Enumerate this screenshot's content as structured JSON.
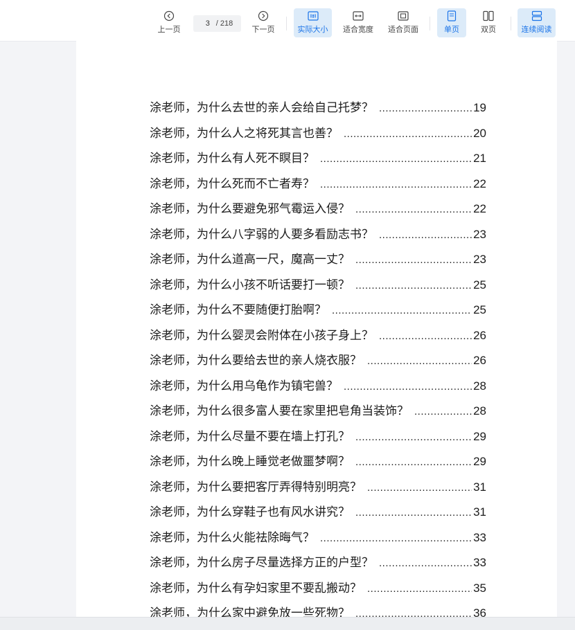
{
  "toolbar": {
    "prev_label": "上一页",
    "next_label": "下一页",
    "current_page": "3",
    "total_pages": "/ 218",
    "actual_size_label": "实际大小",
    "fit_width_label": "适合宽度",
    "fit_page_label": "适合页面",
    "single_page_label": "单页",
    "double_page_label": "双页",
    "continuous_label": "连续阅读",
    "accent_color": "#1a73e8"
  },
  "toc": [
    {
      "title": "涂老师，为什么去世的亲人会给自己托梦？",
      "page": "19"
    },
    {
      "title": "涂老师，为什么人之将死其言也善？",
      "page": "20"
    },
    {
      "title": "涂老师，为什么有人死不瞑目？",
      "page": "21"
    },
    {
      "title": "涂老师，为什么死而不亡者寿？",
      "page": "22"
    },
    {
      "title": "涂老师，为什么要避免邪气霉运入侵？",
      "page": "22"
    },
    {
      "title": "涂老师，为什么八字弱的人要多看励志书？",
      "page": "23"
    },
    {
      "title": "涂老师，为什么道高一尺，魔高一丈？",
      "page": "23"
    },
    {
      "title": "涂老师，为什么小孩不听话要打一顿？",
      "page": "25"
    },
    {
      "title": "涂老师，为什么不要随便打胎啊？",
      "page": "25"
    },
    {
      "title": "涂老师，为什么婴灵会附体在小孩子身上？",
      "page": "26"
    },
    {
      "title": "涂老师，为什么要给去世的亲人烧衣服？",
      "page": "26"
    },
    {
      "title": "涂老师，为什么用乌龟作为镇宅兽？",
      "page": "28"
    },
    {
      "title": "涂老师，为什么很多富人要在家里把皂角当装饰？",
      "page": "28"
    },
    {
      "title": "涂老师，为什么尽量不要在墙上打孔？",
      "page": "29"
    },
    {
      "title": "涂老师，为什么晚上睡觉老做噩梦啊？",
      "page": "29"
    },
    {
      "title": "涂老师，为什么要把客厅弄得特别明亮？",
      "page": "31"
    },
    {
      "title": "涂老师，为什么穿鞋子也有风水讲究？",
      "page": "31"
    },
    {
      "title": "涂老师，为什么火能祛除晦气？",
      "page": "33"
    },
    {
      "title": "涂老师，为什么房子尽量选择方正的户型？",
      "page": "33"
    },
    {
      "title": "涂老师，为什么有孕妇家里不要乱搬动？",
      "page": "35"
    },
    {
      "title": "涂老师，为什么家中避免放一些死物？",
      "page": "36"
    }
  ]
}
